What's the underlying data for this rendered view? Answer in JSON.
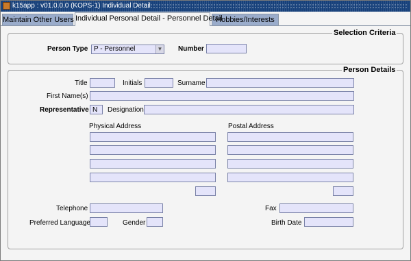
{
  "window": {
    "title": "k15app : v01.0.0.0 (KOPS-1) Individual Detail"
  },
  "tabs": [
    {
      "label": "Maintain Other Users"
    },
    {
      "label": "Individual Personal Detail - Personnel Detail"
    },
    {
      "label": "Hobbies/Interests"
    }
  ],
  "selection": {
    "title": "Selection Criteria",
    "person_type_label": "Person Type",
    "person_type_value": "P - Personnel",
    "number_label": "Number",
    "number_value": ""
  },
  "person": {
    "title": "Person Details",
    "title_label": "Title",
    "initials_label": "Initials",
    "surname_label": "Surname",
    "first_names_label": "First Name(s)",
    "representative_label": "Representative",
    "representative_value": "N",
    "designation_label": "Designation",
    "physical_address_label": "Physical Address",
    "postal_address_label": "Postal Address",
    "telephone_label": "Telephone",
    "fax_label": "Fax",
    "preferred_language_label": "Preferred Language",
    "gender_label": "Gender",
    "birth_date_label": "Birth Date"
  }
}
